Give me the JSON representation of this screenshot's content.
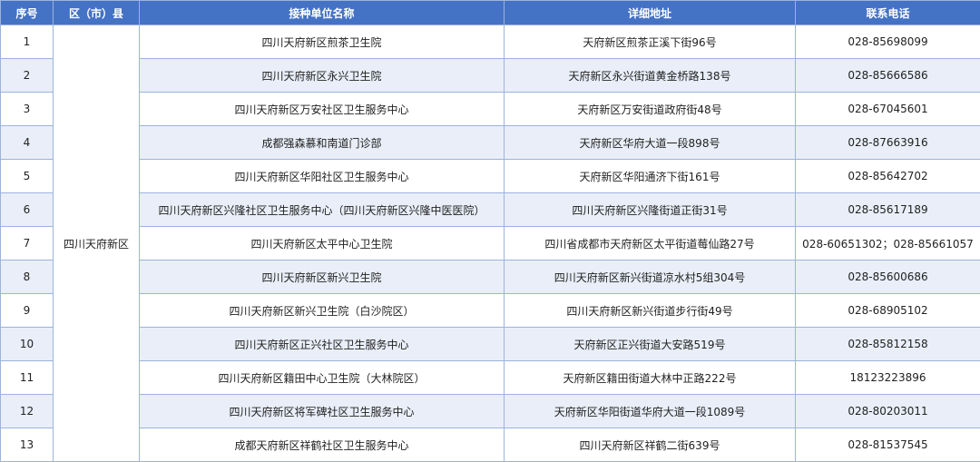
{
  "table": {
    "headers": [
      "序号",
      "区（市）县",
      "接种单位名称",
      "详细地址",
      "联系电话"
    ],
    "district": "四川天府新区",
    "rows": [
      {
        "no": "1",
        "name": "四川天府新区煎茶卫生院",
        "address": "天府新区煎茶正溪下街96号",
        "phone": "028-85698099"
      },
      {
        "no": "2",
        "name": "四川天府新区永兴卫生院",
        "address": "天府新区永兴街道黄金桥路138号",
        "phone": "028-85666586"
      },
      {
        "no": "3",
        "name": "四川天府新区万安社区卫生服务中心",
        "address": "天府新区万安街道政府街48号",
        "phone": "028-67045601"
      },
      {
        "no": "4",
        "name": "成都强森慕和南道门诊部",
        "address": "天府新区华府大道一段898号",
        "phone": "028-87663916"
      },
      {
        "no": "5",
        "name": "四川天府新区华阳社区卫生服务中心",
        "address": "天府新区华阳通济下街161号",
        "phone": "028-85642702"
      },
      {
        "no": "6",
        "name": "四川天府新区兴隆社区卫生服务中心（四川天府新区兴隆中医医院）",
        "address": "四川天府新区兴隆街道正街31号",
        "phone": "028-85617189"
      },
      {
        "no": "7",
        "name": "四川天府新区太平中心卫生院",
        "address": "四川省成都市天府新区太平街道莓仙路27号",
        "phone": "028-60651302；028-85661057"
      },
      {
        "no": "8",
        "name": "四川天府新区新兴卫生院",
        "address": "四川天府新区新兴街道凉水村5组304号",
        "phone": "028-85600686"
      },
      {
        "no": "9",
        "name": "四川天府新区新兴卫生院（白沙院区）",
        "address": "四川天府新区新兴街道步行街49号",
        "phone": "028-68905102"
      },
      {
        "no": "10",
        "name": "四川天府新区正兴社区卫生服务中心",
        "address": "天府新区正兴街道大安路519号",
        "phone": "028-85812158"
      },
      {
        "no": "11",
        "name": "四川天府新区籍田中心卫生院（大林院区）",
        "address": "天府新区籍田街道大林中正路222号",
        "phone": "18123223896"
      },
      {
        "no": "12",
        "name": "四川天府新区将军碑社区卫生服务中心",
        "address": "天府新区华阳街道华府大道一段1089号",
        "phone": "028-80203011"
      },
      {
        "no": "13",
        "name": "成都天府新区祥鹤社区卫生服务中心",
        "address": "四川天府新区祥鹤二街639号",
        "phone": "028-81537545"
      }
    ]
  }
}
